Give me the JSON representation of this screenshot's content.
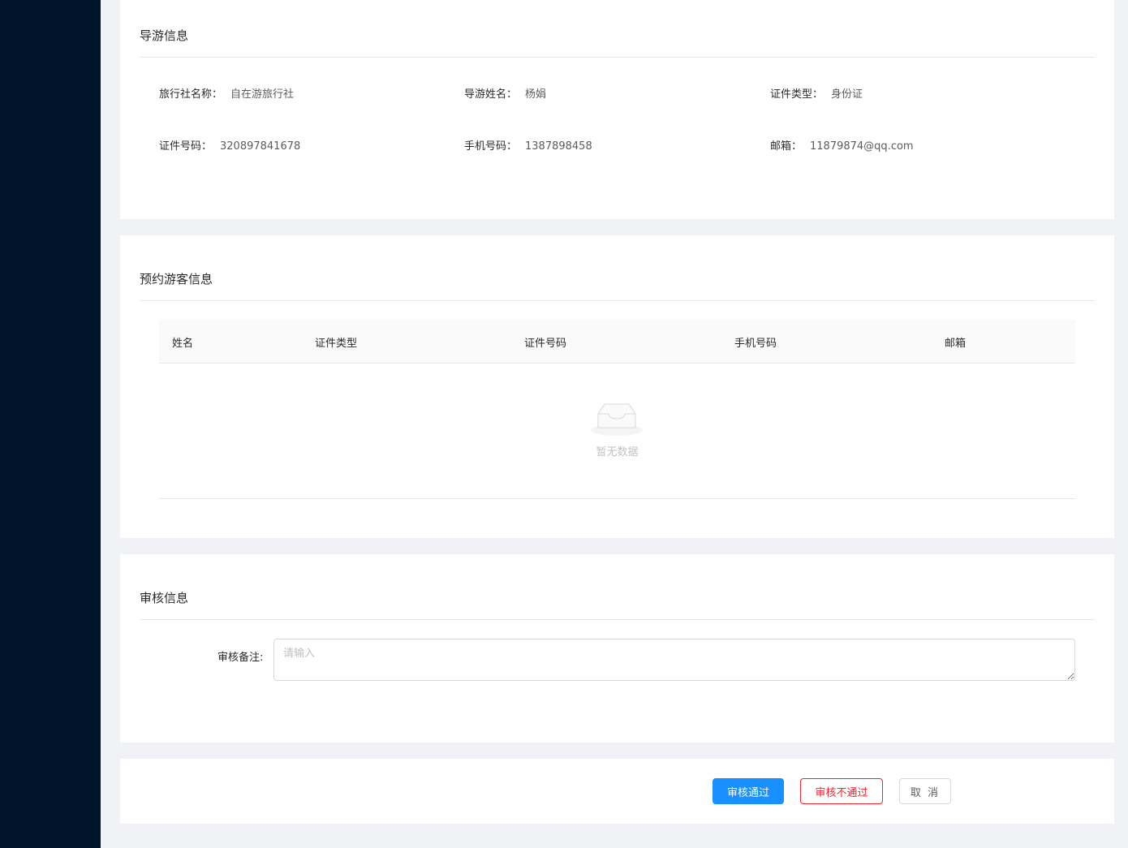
{
  "guide": {
    "title": "导游信息",
    "fields": [
      {
        "label": "旅行社名称：",
        "value": "自在游旅行社"
      },
      {
        "label": "导游姓名：",
        "value": "杨娟"
      },
      {
        "label": "证件类型：",
        "value": "身份证"
      },
      {
        "label": "证件号码：",
        "value": "320897841678"
      },
      {
        "label": "手机号码：",
        "value": "1387898458"
      },
      {
        "label": "邮箱：",
        "value": "11879874@qq.com"
      }
    ]
  },
  "tourists": {
    "title": "预约游客信息",
    "columns": [
      "姓名",
      "证件类型",
      "证件号码",
      "手机号码",
      "邮箱"
    ],
    "empty_text": "暂无数据"
  },
  "audit": {
    "title": "审核信息",
    "remark_label": "审核备注:",
    "remark_placeholder": "请输入",
    "remark_value": ""
  },
  "actions": {
    "approve": "审核通过",
    "reject": "审核不通过",
    "cancel": "取 消"
  },
  "colors": {
    "sidebar": "#001529",
    "primary": "#1890ff",
    "danger": "#f5222d",
    "background": "#f0f2f5"
  },
  "icons": {
    "empty": "empty-inbox-icon"
  }
}
